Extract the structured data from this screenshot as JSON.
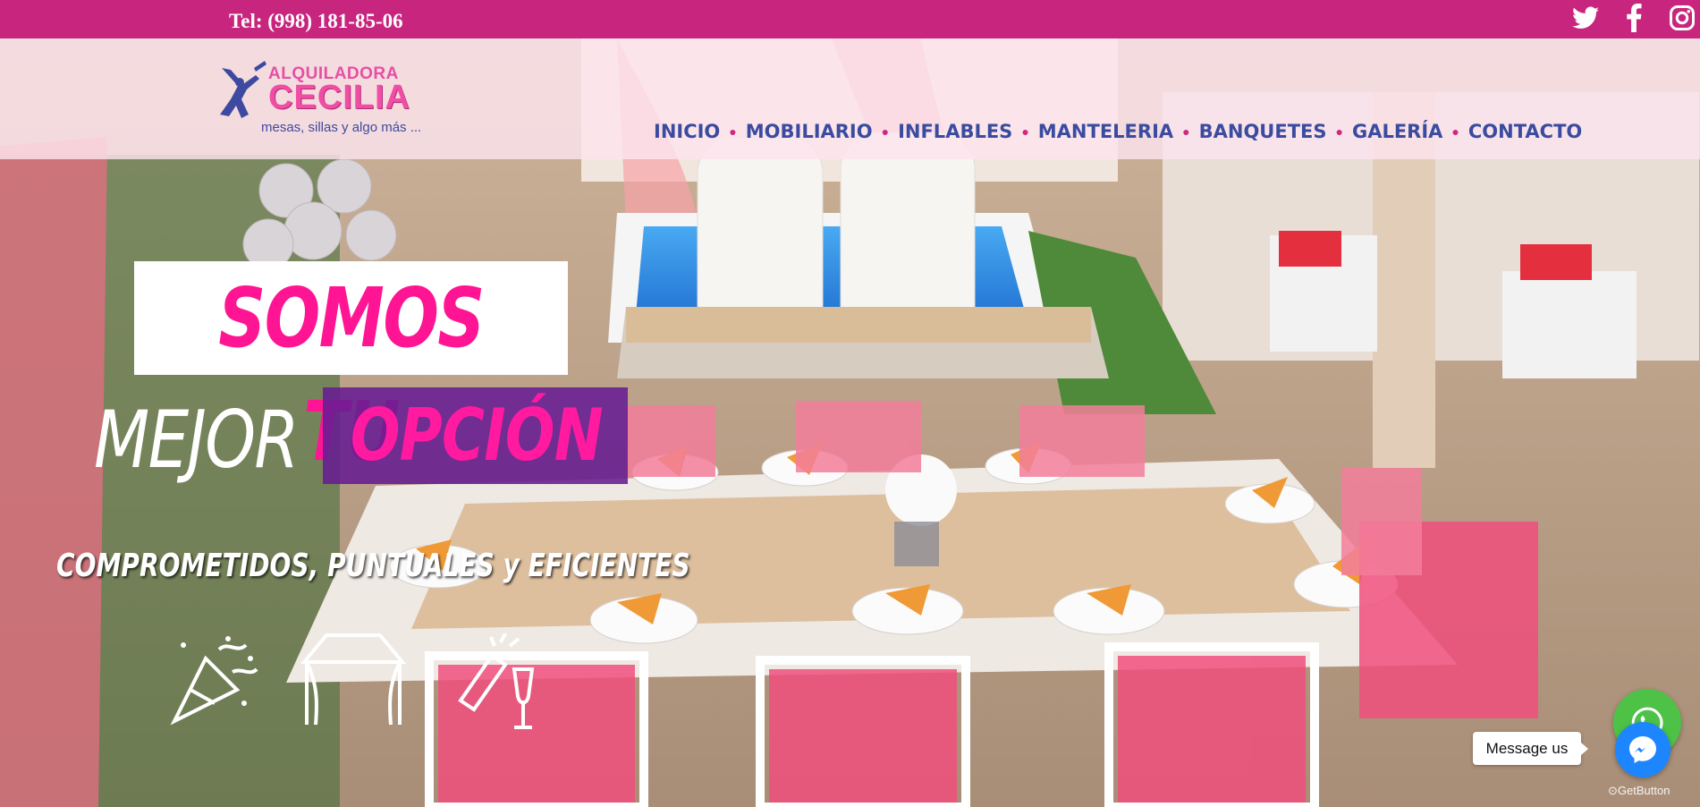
{
  "topbar": {
    "phone": "Tel: (998) 181-85-06",
    "social": [
      "twitter-icon",
      "facebook-icon",
      "instagram-icon"
    ]
  },
  "logo": {
    "line1": "ALQUILADORA",
    "line2": "CECILIA",
    "tagline": "mesas, sillas y algo más ..."
  },
  "nav": {
    "items": [
      {
        "label": "INICIO"
      },
      {
        "label": "MOBILIARIO"
      },
      {
        "label": "INFLABLES"
      },
      {
        "label": "MANTELERIA"
      },
      {
        "label": "BANQUETES"
      },
      {
        "label": "GALERÍA"
      },
      {
        "label": "CONTACTO"
      }
    ]
  },
  "hero": {
    "headline_1": "SOMOS TU",
    "headline_2a": "MEJOR",
    "headline_2b": "OPCIÓN",
    "subheadline": "COMPROMETIDOS, PUNTUALES y EFICIENTES",
    "feature_icons": [
      "party-popper-icon",
      "tent-icon",
      "champagne-toast-icon"
    ]
  },
  "widgets": {
    "message_label": "Message us",
    "getbutton_label": "GetButton"
  },
  "colors": {
    "topbar": "#c8267e",
    "nav_text": "#3a4ba0",
    "accent_pink": "#ff1493",
    "purple_box": "#661c92",
    "whatsapp": "#4dc247",
    "messenger": "#1d86ff"
  }
}
